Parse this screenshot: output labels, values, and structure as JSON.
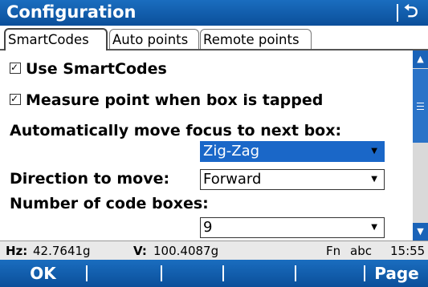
{
  "window": {
    "title": "Configuration",
    "back_icon": "back-arrow-icon"
  },
  "tabs": [
    {
      "label": "SmartCodes",
      "active": true
    },
    {
      "label": "Auto points",
      "active": false
    },
    {
      "label": "Remote points",
      "active": false
    }
  ],
  "settings": {
    "use_smartcodes": {
      "label": "Use SmartCodes",
      "checked": true
    },
    "measure_on_tap": {
      "label": "Measure point when box is tapped",
      "checked": true
    },
    "auto_move": {
      "label": "Automatically move focus to next box:",
      "value": "Zig-Zag"
    },
    "direction": {
      "label": "Direction to move:",
      "value": "Forward"
    },
    "code_boxes": {
      "label": "Number of code boxes:",
      "value": "9"
    }
  },
  "status": {
    "hz_label": "Hz:",
    "hz_value": "42.7641g",
    "v_label": "V:",
    "v_value": "100.4087g",
    "fn": "Fn",
    "input_mode": "abc",
    "time": "15:55"
  },
  "softkeys": {
    "ok": "OK",
    "page": "Page"
  },
  "colors": {
    "accent": "#0b4f9a",
    "selection": "#1a67c8"
  }
}
